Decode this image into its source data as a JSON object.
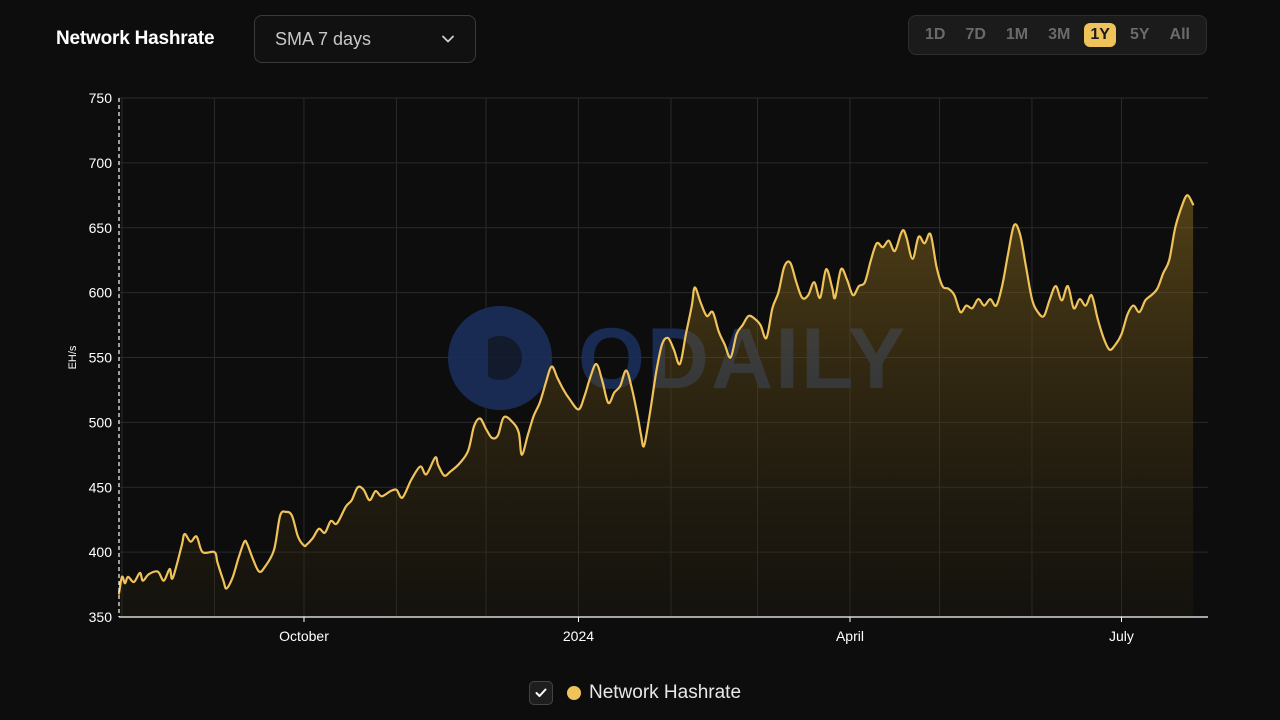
{
  "header": {
    "title": "Network Hashrate",
    "sma_select": {
      "value": "SMA 7 days"
    },
    "ranges": [
      {
        "label": "1D",
        "active": false
      },
      {
        "label": "7D",
        "active": false
      },
      {
        "label": "1M",
        "active": false
      },
      {
        "label": "3M",
        "active": false
      },
      {
        "label": "1Y",
        "active": true
      },
      {
        "label": "5Y",
        "active": false
      },
      {
        "label": "All",
        "active": false
      }
    ]
  },
  "legend": {
    "label": "Network Hashrate",
    "checked": true
  },
  "watermark": "ODAILY",
  "colors": {
    "line": "#f0c35a",
    "background": "#0d0d0d",
    "grid": "#2a2a2a",
    "active_range": "#f0c35a"
  },
  "chart_data": {
    "type": "area",
    "xlabel": "",
    "ylabel": "EH/s",
    "ylim": [
      350,
      750
    ],
    "yticks": [
      350,
      400,
      450,
      500,
      550,
      600,
      650,
      700,
      750
    ],
    "xlim": [
      "2023-07-31",
      "2024-07-30"
    ],
    "xticks": [
      {
        "date": "2023-10-01",
        "label": "October"
      },
      {
        "date": "2024-01-01",
        "label": "2024"
      },
      {
        "date": "2024-04-01",
        "label": "April"
      },
      {
        "date": "2024-07-01",
        "label": "July"
      }
    ],
    "grid": true,
    "legend_position": "bottom-center",
    "series": [
      {
        "name": "Network Hashrate",
        "points": [
          [
            "2023-07-31",
            368
          ],
          [
            "2023-08-01",
            381
          ],
          [
            "2023-08-02",
            376
          ],
          [
            "2023-08-03",
            381
          ],
          [
            "2023-08-05",
            377
          ],
          [
            "2023-08-07",
            384
          ],
          [
            "2023-08-08",
            378
          ],
          [
            "2023-08-10",
            383
          ],
          [
            "2023-08-13",
            385
          ],
          [
            "2023-08-15",
            378
          ],
          [
            "2023-08-17",
            387
          ],
          [
            "2023-08-18",
            380
          ],
          [
            "2023-08-21",
            405
          ],
          [
            "2023-08-22",
            414
          ],
          [
            "2023-08-24",
            408
          ],
          [
            "2023-08-26",
            412
          ],
          [
            "2023-08-28",
            400
          ],
          [
            "2023-09-01",
            400
          ],
          [
            "2023-09-02",
            392
          ],
          [
            "2023-09-04",
            378
          ],
          [
            "2023-09-05",
            372
          ],
          [
            "2023-09-07",
            380
          ],
          [
            "2023-09-09",
            395
          ],
          [
            "2023-09-11",
            408
          ],
          [
            "2023-09-12",
            406
          ],
          [
            "2023-09-14",
            394
          ],
          [
            "2023-09-16",
            385
          ],
          [
            "2023-09-18",
            389
          ],
          [
            "2023-09-21",
            402
          ],
          [
            "2023-09-23",
            428
          ],
          [
            "2023-09-25",
            431
          ],
          [
            "2023-09-27",
            428
          ],
          [
            "2023-09-29",
            412
          ],
          [
            "2023-10-01",
            405
          ],
          [
            "2023-10-02",
            406
          ],
          [
            "2023-10-04",
            411
          ],
          [
            "2023-10-06",
            418
          ],
          [
            "2023-10-08",
            415
          ],
          [
            "2023-10-10",
            424
          ],
          [
            "2023-10-12",
            422
          ],
          [
            "2023-10-15",
            435
          ],
          [
            "2023-10-17",
            440
          ],
          [
            "2023-10-19",
            450
          ],
          [
            "2023-10-21",
            448
          ],
          [
            "2023-10-23",
            440
          ],
          [
            "2023-10-25",
            447
          ],
          [
            "2023-10-27",
            443
          ],
          [
            "2023-10-30",
            447
          ],
          [
            "2023-11-01",
            448
          ],
          [
            "2023-11-03",
            442
          ],
          [
            "2023-11-06",
            456
          ],
          [
            "2023-11-09",
            466
          ],
          [
            "2023-11-11",
            460
          ],
          [
            "2023-11-14",
            473
          ],
          [
            "2023-11-15",
            467
          ],
          [
            "2023-11-17",
            459
          ],
          [
            "2023-11-19",
            462
          ],
          [
            "2023-11-22",
            468
          ],
          [
            "2023-11-25",
            478
          ],
          [
            "2023-11-27",
            497
          ],
          [
            "2023-11-29",
            503
          ],
          [
            "2023-12-01",
            495
          ],
          [
            "2023-12-03",
            488
          ],
          [
            "2023-12-05",
            490
          ],
          [
            "2023-12-07",
            504
          ],
          [
            "2023-12-10",
            500
          ],
          [
            "2023-12-12",
            492
          ],
          [
            "2023-12-13",
            475
          ],
          [
            "2023-12-15",
            490
          ],
          [
            "2023-12-17",
            505
          ],
          [
            "2023-12-19",
            515
          ],
          [
            "2023-12-21",
            530
          ],
          [
            "2023-12-23",
            543
          ],
          [
            "2023-12-25",
            534
          ],
          [
            "2023-12-27",
            525
          ],
          [
            "2023-12-29",
            518
          ],
          [
            "2024-01-01",
            510
          ],
          [
            "2024-01-03",
            520
          ],
          [
            "2024-01-05",
            535
          ],
          [
            "2024-01-07",
            545
          ],
          [
            "2024-01-09",
            532
          ],
          [
            "2024-01-11",
            515
          ],
          [
            "2024-01-13",
            523
          ],
          [
            "2024-01-15",
            528
          ],
          [
            "2024-01-17",
            540
          ],
          [
            "2024-01-19",
            525
          ],
          [
            "2024-01-21",
            503
          ],
          [
            "2024-01-22",
            490
          ],
          [
            "2024-01-23",
            482
          ],
          [
            "2024-01-25",
            508
          ],
          [
            "2024-01-27",
            538
          ],
          [
            "2024-01-29",
            560
          ],
          [
            "2024-01-31",
            565
          ],
          [
            "2024-02-02",
            556
          ],
          [
            "2024-02-04",
            545
          ],
          [
            "2024-02-06",
            568
          ],
          [
            "2024-02-08",
            590
          ],
          [
            "2024-02-09",
            604
          ],
          [
            "2024-02-11",
            592
          ],
          [
            "2024-02-13",
            582
          ],
          [
            "2024-02-15",
            585
          ],
          [
            "2024-02-17",
            570
          ],
          [
            "2024-02-19",
            560
          ],
          [
            "2024-02-21",
            550
          ],
          [
            "2024-02-23",
            568
          ],
          [
            "2024-02-25",
            575
          ],
          [
            "2024-02-27",
            582
          ],
          [
            "2024-02-29",
            580
          ],
          [
            "2024-03-02",
            575
          ],
          [
            "2024-03-04",
            565
          ],
          [
            "2024-03-06",
            588
          ],
          [
            "2024-03-08",
            600
          ],
          [
            "2024-03-10",
            620
          ],
          [
            "2024-03-12",
            623
          ],
          [
            "2024-03-14",
            608
          ],
          [
            "2024-03-16",
            596
          ],
          [
            "2024-03-18",
            598
          ],
          [
            "2024-03-20",
            608
          ],
          [
            "2024-03-22",
            596
          ],
          [
            "2024-03-24",
            618
          ],
          [
            "2024-03-26",
            604
          ],
          [
            "2024-03-27",
            596
          ],
          [
            "2024-03-29",
            618
          ],
          [
            "2024-03-31",
            610
          ],
          [
            "2024-04-02",
            598
          ],
          [
            "2024-04-04",
            605
          ],
          [
            "2024-04-06",
            608
          ],
          [
            "2024-04-08",
            625
          ],
          [
            "2024-04-10",
            638
          ],
          [
            "2024-04-12",
            635
          ],
          [
            "2024-04-14",
            640
          ],
          [
            "2024-04-16",
            632
          ],
          [
            "2024-04-18",
            645
          ],
          [
            "2024-04-19",
            648
          ],
          [
            "2024-04-20",
            642
          ],
          [
            "2024-04-22",
            626
          ],
          [
            "2024-04-24",
            643
          ],
          [
            "2024-04-26",
            638
          ],
          [
            "2024-04-28",
            645
          ],
          [
            "2024-04-30",
            620
          ],
          [
            "2024-05-02",
            605
          ],
          [
            "2024-05-04",
            603
          ],
          [
            "2024-05-06",
            598
          ],
          [
            "2024-05-08",
            585
          ],
          [
            "2024-05-10",
            590
          ],
          [
            "2024-05-12",
            588
          ],
          [
            "2024-05-14",
            595
          ],
          [
            "2024-05-16",
            590
          ],
          [
            "2024-05-18",
            595
          ],
          [
            "2024-05-20",
            590
          ],
          [
            "2024-05-22",
            605
          ],
          [
            "2024-05-24",
            630
          ],
          [
            "2024-05-26",
            652
          ],
          [
            "2024-05-28",
            645
          ],
          [
            "2024-05-30",
            620
          ],
          [
            "2024-06-01",
            595
          ],
          [
            "2024-06-03",
            585
          ],
          [
            "2024-06-05",
            582
          ],
          [
            "2024-06-07",
            595
          ],
          [
            "2024-06-09",
            605
          ],
          [
            "2024-06-11",
            594
          ],
          [
            "2024-06-13",
            605
          ],
          [
            "2024-06-15",
            588
          ],
          [
            "2024-06-17",
            595
          ],
          [
            "2024-06-19",
            590
          ],
          [
            "2024-06-21",
            598
          ],
          [
            "2024-06-23",
            580
          ],
          [
            "2024-06-25",
            565
          ],
          [
            "2024-06-27",
            556
          ],
          [
            "2024-06-29",
            560
          ],
          [
            "2024-07-01",
            568
          ],
          [
            "2024-07-03",
            583
          ],
          [
            "2024-07-05",
            590
          ],
          [
            "2024-07-07",
            585
          ],
          [
            "2024-07-09",
            594
          ],
          [
            "2024-07-11",
            598
          ],
          [
            "2024-07-13",
            603
          ],
          [
            "2024-07-15",
            615
          ],
          [
            "2024-07-17",
            625
          ],
          [
            "2024-07-19",
            650
          ],
          [
            "2024-07-21",
            665
          ],
          [
            "2024-07-23",
            675
          ],
          [
            "2024-07-25",
            668
          ]
        ]
      }
    ]
  }
}
